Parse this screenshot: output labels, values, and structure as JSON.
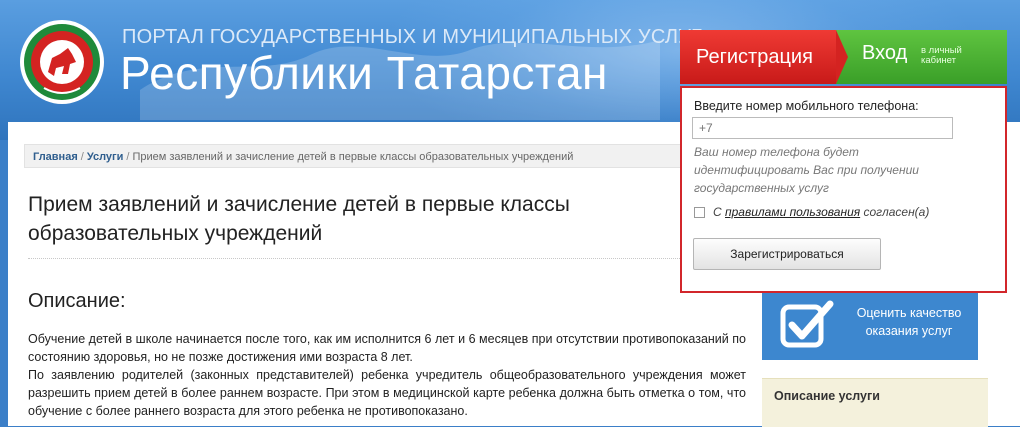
{
  "header": {
    "subtitle": "ПОРТАЛ ГОСУДАРСТВЕННЫХ И МУНИЦИПАЛЬНЫХ УСЛУГ",
    "title": "Республики Татарстан"
  },
  "breadcrumb": {
    "items": [
      "Главная",
      "Услуги"
    ],
    "current": "Прием заявлений и зачисление детей в первые классы образовательных учреждений"
  },
  "page": {
    "title": "Прием заявлений и зачисление детей в первые классы образовательных учреждений",
    "description_heading": "Описание:",
    "description_paragraphs": [
      "Обучение детей в школе начинается после того, как им исполнится 6 лет и 6 месяцев при отсутствии противопоказаний по состоянию здоровья, но не позже достижения ими возраста 8 лет.",
      "По заявлению родителей (законных представителей) ребенка учредитель общеобразовательного учреждения может разрешить прием детей в более раннем возрасте. При этом в медицинской карте ребенка должна быть отметка о том, что обучение с более раннего возраста для этого ребенка не противопоказано."
    ]
  },
  "auth": {
    "register_tab": "Регистрация",
    "login_tab": "Вход",
    "login_sub_line1": "в личный",
    "login_sub_line2": "кабинет",
    "phone_label": "Введите номер мобильного телефона:",
    "phone_placeholder": "+7",
    "hint": "Ваш номер телефона будет идентифицировать Вас при получении государственных услуг",
    "agree_prefix": "С",
    "agree_link": "правилами пользования",
    "agree_suffix": "согласен(а)",
    "register_button": "Зарегистрироваться"
  },
  "sidebar": {
    "rate_label": "Оценить качество оказания услуг",
    "service_description": "Описание услуги"
  },
  "colors": {
    "register_tab": "#d42321",
    "login_tab": "#4cb234",
    "panel_border": "#d2262b",
    "header_blue": "#3f87d0",
    "rate_box": "#3d87cf"
  },
  "icons": {
    "logo": "tatarstan-emblem-icon",
    "rate": "checkbox-check-icon"
  }
}
